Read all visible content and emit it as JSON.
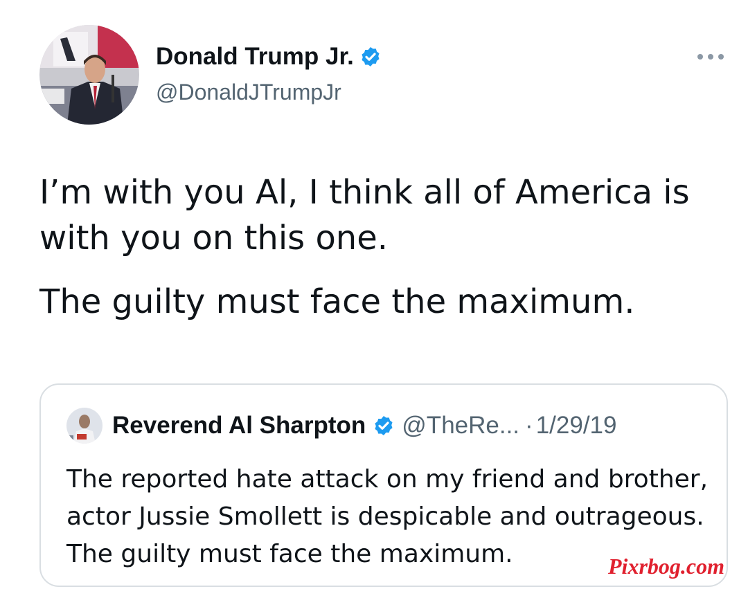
{
  "tweet": {
    "author": {
      "name": "Donald Trump Jr.",
      "handle": "@DonaldJTrumpJr",
      "verified_icon": "verified-badge-icon",
      "avatar_icon": "profile-photo"
    },
    "more_icon": "more-options-icon",
    "body": [
      "I’m with you Al, I think all of America is with you on this one.",
      "The guilty must face the maximum."
    ]
  },
  "quoted_tweet": {
    "author": {
      "name": "Reverend Al Sharpton",
      "handle": "@TheRe...",
      "separator": "·",
      "date": "1/29/19",
      "verified_icon": "verified-badge-icon",
      "avatar_icon": "profile-photo"
    },
    "body": "The reported hate attack on my friend and brother, actor Jussie Smollett is despicable and outrageous. The guilty must face the maximum."
  },
  "watermark": {
    "text": "Pixrbog.com"
  },
  "colors": {
    "text_primary": "#0f1419",
    "text_secondary": "#536471",
    "verified_blue": "#1d9bf0",
    "card_border": "#d9dee2",
    "watermark_red": "#e0202e"
  }
}
